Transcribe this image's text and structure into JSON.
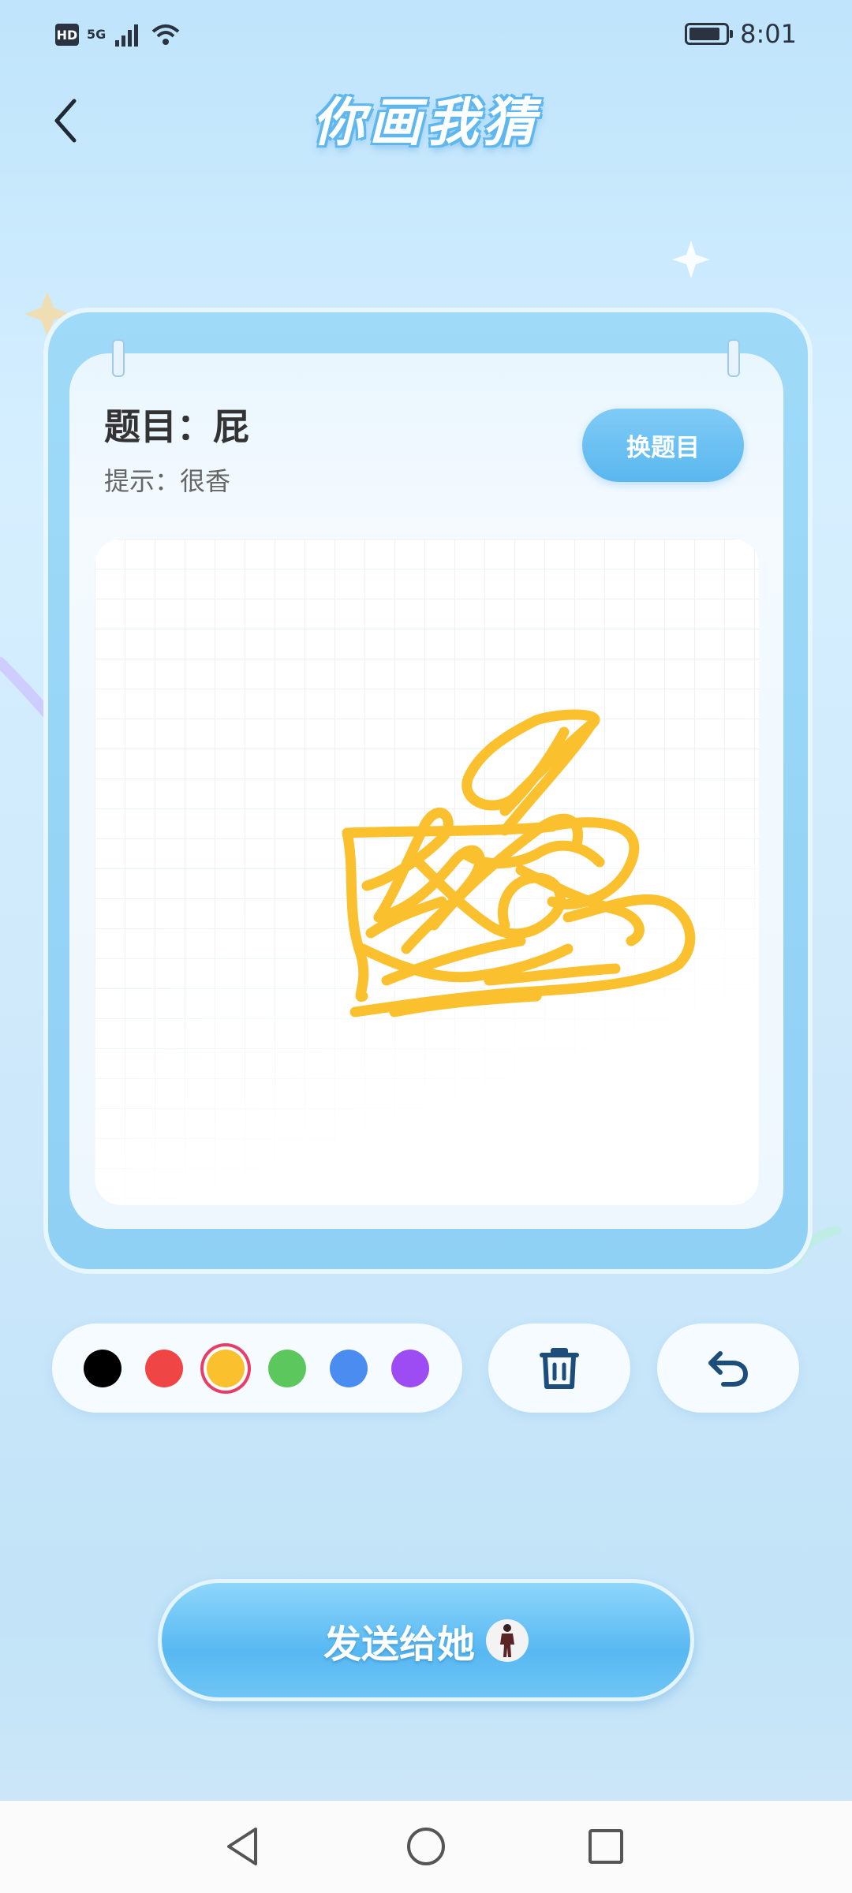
{
  "status_bar": {
    "hd_badge": "HD",
    "network": "5G",
    "time": "8:01",
    "battery_level": 0.85
  },
  "header": {
    "title": "你画我猜"
  },
  "topic": {
    "label": "题目：屁",
    "hint": "提示：很香",
    "change_button": "换题目"
  },
  "toolbar": {
    "colors": [
      "#000000",
      "#f04545",
      "#fbc02d",
      "#5cc75c",
      "#4a8cf0",
      "#9c4cf2"
    ],
    "selected_color_index": 2,
    "clear_icon": "trash-icon",
    "undo_icon": "undo-icon"
  },
  "drawing": {
    "stroke_color": "#fbc02d"
  },
  "send": {
    "label": "发送给她"
  },
  "navigation": {
    "back_icon": "triangle-back-icon",
    "home_icon": "circle-home-icon",
    "recents_icon": "square-recents-icon"
  }
}
